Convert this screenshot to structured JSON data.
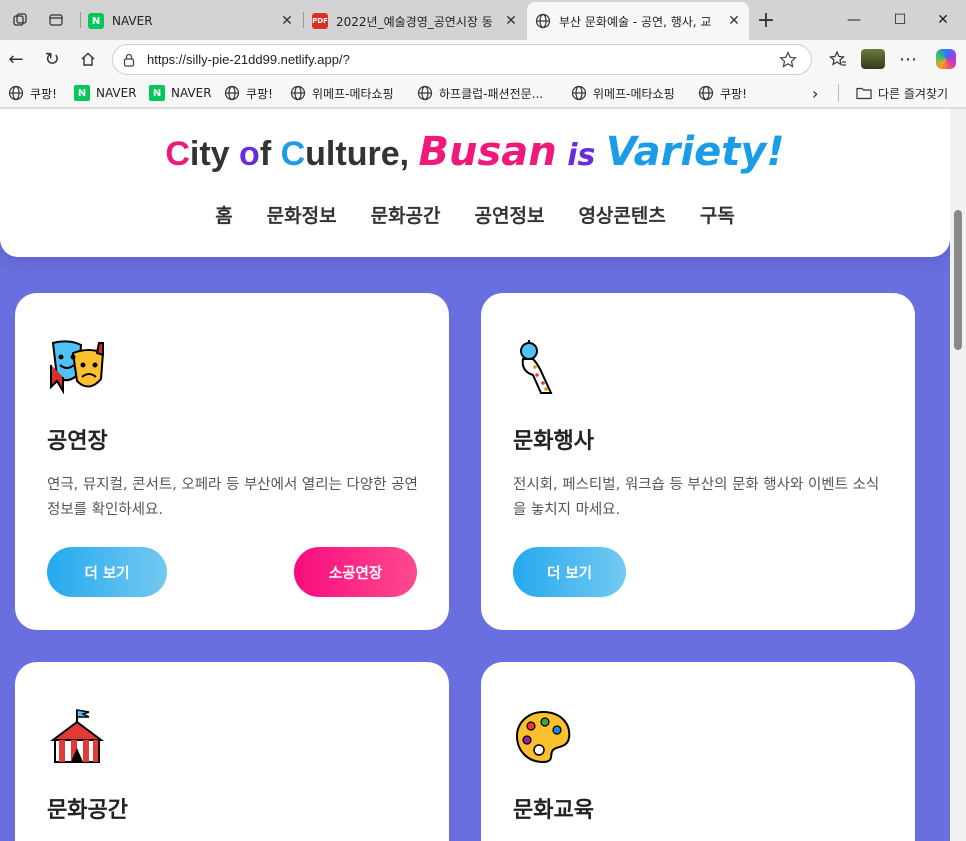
{
  "browser": {
    "tabs": [
      {
        "title": "NAVER",
        "favicon": "naver-icon"
      },
      {
        "title": "2022년_예술경영_공연시장 동",
        "favicon": "pdf-icon"
      },
      {
        "title": "부산 문화예술 - 공연, 행사, 교",
        "favicon": "globe-icon"
      }
    ],
    "address": "https://silly-pie-21dd99.netlify.app/?",
    "bookmarks": [
      {
        "label": "쿠팡!",
        "icon": "globe-icon"
      },
      {
        "label": "NAVER",
        "icon": "naver-icon"
      },
      {
        "label": "NAVER",
        "icon": "naver-icon"
      },
      {
        "label": "쿠팡!",
        "icon": "globe-icon"
      },
      {
        "label": "위메프-메타쇼핑",
        "icon": "globe-icon"
      },
      {
        "label": "하프클럽-패션전문...",
        "icon": "globe-icon"
      },
      {
        "label": "위메프-메타쇼핑",
        "icon": "globe-icon"
      },
      {
        "label": "쿠팡!",
        "icon": "globe-icon"
      }
    ],
    "other_favorites": "다른 즐겨찾기"
  },
  "site": {
    "title_parts": {
      "c1": "C",
      "ity": "ity ",
      "o": "o",
      "f": "f ",
      "c2": "C",
      "ulture": "ulture, ",
      "busan": "Busan",
      "is": " is ",
      "variety": "Variety!"
    },
    "nav": [
      "홈",
      "문화정보",
      "문화공간",
      "공연정보",
      "영상콘텐츠",
      "구독"
    ]
  },
  "cards": [
    {
      "title": "공연장",
      "icon": "theater-masks-icon",
      "desc": "연극, 뮤지컬, 콘서트, 오페라 등 부산에서 열리는 다양한 공연 정보를 확인하세요.",
      "primary": "더 보기",
      "secondary": "소공연장"
    },
    {
      "title": "문화행사",
      "icon": "party-popper-icon",
      "desc": "전시회, 페스티벌, 워크숍 등 부산의 문화 행사와 이벤트 소식을 놓치지 마세요.",
      "primary": "더 보기"
    },
    {
      "title": "문화공간",
      "icon": "circus-tent-icon"
    },
    {
      "title": "문화교육",
      "icon": "artist-palette-icon"
    }
  ],
  "colors": {
    "page_bg": "#6a6fdf",
    "brand_pink": "#f0187a",
    "brand_purple": "#6a2be0",
    "brand_blue": "#1a9ce8"
  }
}
